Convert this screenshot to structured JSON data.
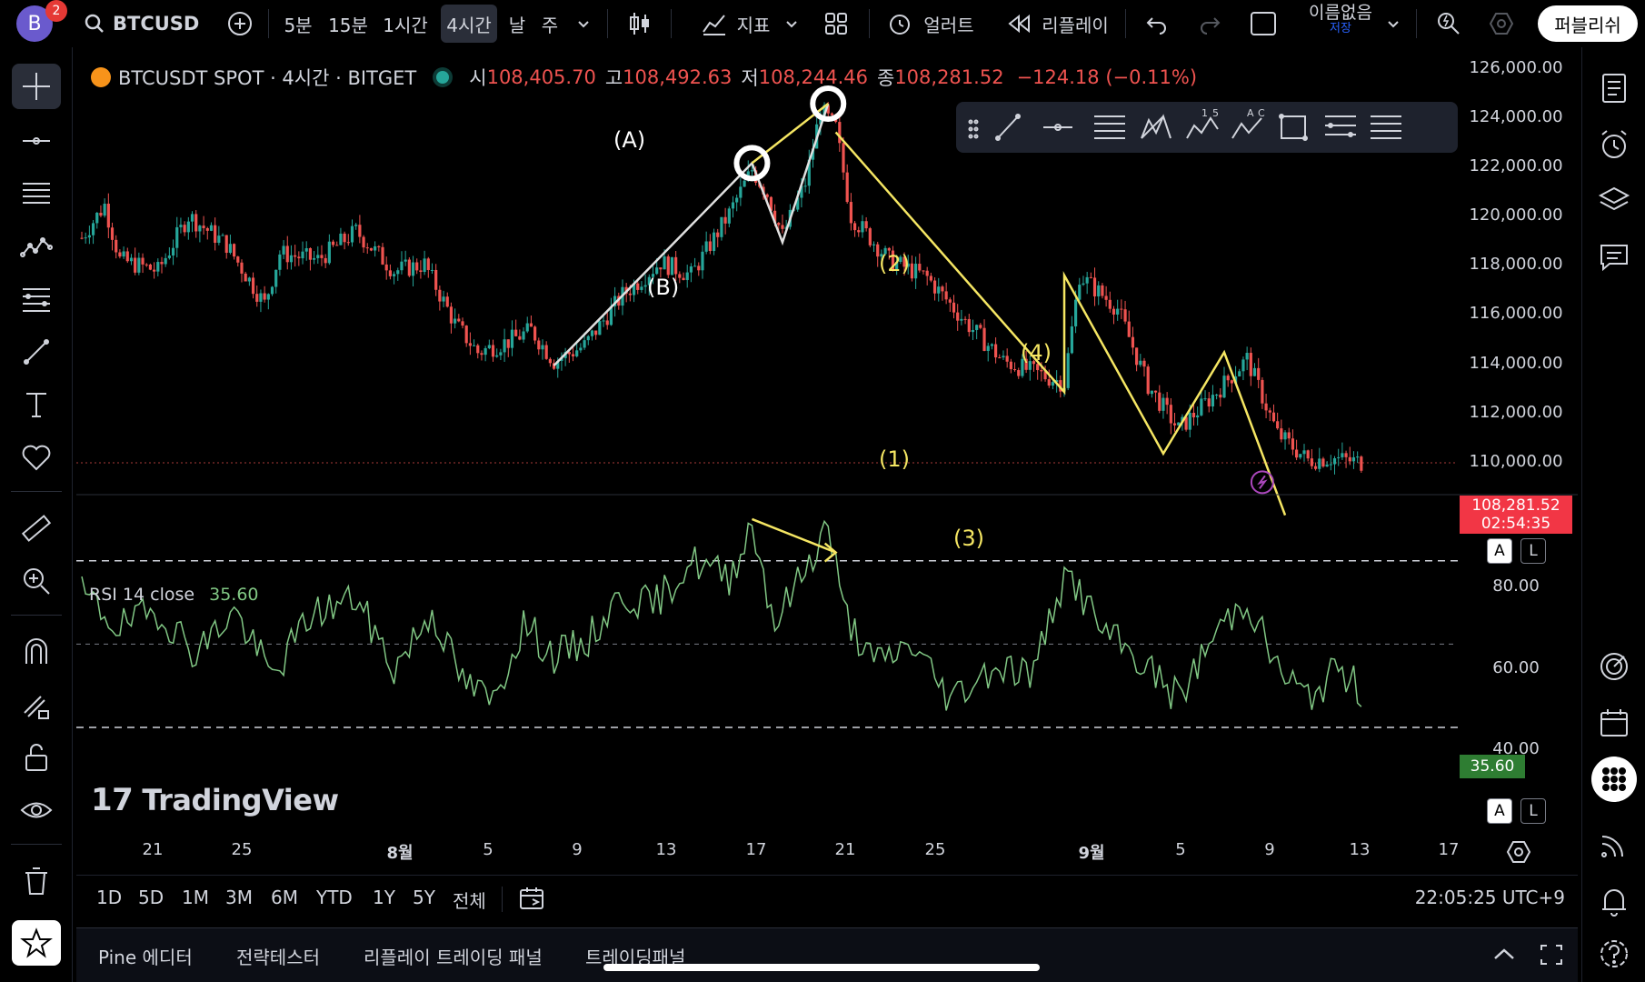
{
  "topbar": {
    "avatar_letter": "B",
    "notification_count": "2",
    "symbol": "BTCUSD",
    "intervals": [
      "5분",
      "15분",
      "1시간",
      "4시간",
      "날",
      "주"
    ],
    "active_interval": "4시간",
    "indicators_label": "지표",
    "alert_label": "얼러트",
    "replay_label": "리플레이",
    "layout_name": "이름없음",
    "layout_status": "저장",
    "publish_label": "퍼블리쉬"
  },
  "legend": {
    "title": "BTCUSDT SPOT · 4시간 · BITGET",
    "open_label": "시",
    "open": "108,405.70",
    "high_label": "고",
    "high": "108,492.63",
    "low_label": "저",
    "low": "108,244.46",
    "close_label": "종",
    "close": "108,281.52",
    "change": "−124.18 (−0.11%)"
  },
  "price_axis": {
    "labels": [
      "126,000.00",
      "124,000.00",
      "122,000.00",
      "120,000.00",
      "118,000.00",
      "116,000.00",
      "114,000.00",
      "112,000.00",
      "110,000.00"
    ],
    "last_price": "108,281.52",
    "countdown": "02:54:35"
  },
  "rsi": {
    "name": "RSI",
    "params": "14 close",
    "value": "35.60",
    "axis_labels": [
      "80.00",
      "60.00",
      "40.00"
    ],
    "last_value": "35.60"
  },
  "scale_buttons": {
    "auto": "A",
    "log": "L"
  },
  "wave_labels": {
    "A": "(A)",
    "B": "(B)",
    "w1": "(1)",
    "w2": "(2)",
    "w3": "(3)",
    "w4": "(4)"
  },
  "watermark": "TradingView",
  "time_axis": [
    "21",
    "25",
    "8월",
    "5",
    "9",
    "13",
    "17",
    "21",
    "25",
    "9월",
    "5",
    "9",
    "13",
    "17"
  ],
  "range_bar": {
    "ranges": [
      "1D",
      "5D",
      "1M",
      "3M",
      "6M",
      "YTD",
      "1Y",
      "5Y",
      "전체"
    ],
    "clock": "22:05:25 UTC+9"
  },
  "bottom_panel": {
    "tabs": [
      "Pine 에디터",
      "전략테스터",
      "리플레이 트레이딩 패널",
      "트레이딩패널"
    ]
  },
  "colors": {
    "up": "#26a69a",
    "down": "#ef5350",
    "wave": "#f5e663",
    "rsi": "#81c784",
    "last_price_bg": "#f23645"
  },
  "chart_data": {
    "type": "candlestick",
    "symbol": "BTCUSDT SPOT",
    "interval": "4시간",
    "exchange": "BITGET",
    "y_range": [
      107000,
      126500
    ],
    "price_path": [
      [
        0,
        118500
      ],
      [
        6,
        120000
      ],
      [
        10,
        117500
      ],
      [
        20,
        117000
      ],
      [
        28,
        119500
      ],
      [
        38,
        118200
      ],
      [
        48,
        115500
      ],
      [
        52,
        117800
      ],
      [
        62,
        117500
      ],
      [
        72,
        118800
      ],
      [
        82,
        117000
      ],
      [
        90,
        117300
      ],
      [
        98,
        114600
      ],
      [
        104,
        113300
      ],
      [
        112,
        113800
      ],
      [
        118,
        114300
      ],
      [
        124,
        112900
      ],
      [
        132,
        113600
      ],
      [
        142,
        115900
      ],
      [
        152,
        117400
      ],
      [
        160,
        116800
      ],
      [
        170,
        119600
      ],
      [
        176,
        121600
      ],
      [
        180,
        120500
      ],
      [
        184,
        118600
      ],
      [
        190,
        121000
      ],
      [
        194,
        124300
      ],
      [
        198,
        123500
      ],
      [
        202,
        119500
      ],
      [
        212,
        117500
      ],
      [
        222,
        116700
      ],
      [
        232,
        114700
      ],
      [
        242,
        112900
      ],
      [
        250,
        112400
      ],
      [
        258,
        111900
      ],
      [
        262,
        116800
      ],
      [
        266,
        116200
      ],
      [
        272,
        115300
      ],
      [
        280,
        111800
      ],
      [
        288,
        109800
      ],
      [
        298,
        111500
      ],
      [
        306,
        113000
      ],
      [
        314,
        109600
      ],
      [
        322,
        108400
      ],
      [
        328,
        108500
      ],
      [
        336,
        108300
      ]
    ],
    "rsi_path": [
      [
        0,
        62
      ],
      [
        10,
        54
      ],
      [
        20,
        58
      ],
      [
        30,
        48
      ],
      [
        40,
        58
      ],
      [
        50,
        42
      ],
      [
        60,
        57
      ],
      [
        72,
        61
      ],
      [
        82,
        44
      ],
      [
        92,
        58
      ],
      [
        100,
        41
      ],
      [
        108,
        36
      ],
      [
        116,
        55
      ],
      [
        124,
        47
      ],
      [
        132,
        50
      ],
      [
        142,
        62
      ],
      [
        150,
        59
      ],
      [
        160,
        70
      ],
      [
        170,
        66
      ],
      [
        176,
        79
      ],
      [
        182,
        55
      ],
      [
        190,
        68
      ],
      [
        196,
        79
      ],
      [
        200,
        58
      ],
      [
        208,
        45
      ],
      [
        218,
        50
      ],
      [
        228,
        37
      ],
      [
        240,
        45
      ],
      [
        250,
        43
      ],
      [
        256,
        62
      ],
      [
        260,
        66
      ],
      [
        268,
        53
      ],
      [
        278,
        46
      ],
      [
        288,
        37
      ],
      [
        298,
        53
      ],
      [
        306,
        61
      ],
      [
        314,
        44
      ],
      [
        322,
        37
      ],
      [
        330,
        44
      ],
      [
        336,
        39
      ]
    ],
    "rsi_range": [
      30,
      85
    ],
    "rsi_levels": [
      70,
      50,
      30
    ],
    "last_price": 108281.52,
    "last_rsi": 35.6
  },
  "annotations": {
    "white_swing": [
      [
        124,
        112700
      ],
      [
        176,
        121900
      ],
      [
        184,
        118300
      ],
      [
        196,
        124600
      ]
    ],
    "yellow_abc": [
      [
        176,
        121900
      ],
      [
        196,
        124600
      ]
    ],
    "yellow_impulse": [
      [
        198,
        123300
      ],
      [
        258,
        111500
      ],
      [
        258,
        116800
      ],
      [
        284,
        108700
      ],
      [
        300,
        113300
      ],
      [
        316,
        105900
      ]
    ],
    "rsi_divergence": [
      [
        176,
        80
      ],
      [
        198,
        72
      ]
    ]
  }
}
